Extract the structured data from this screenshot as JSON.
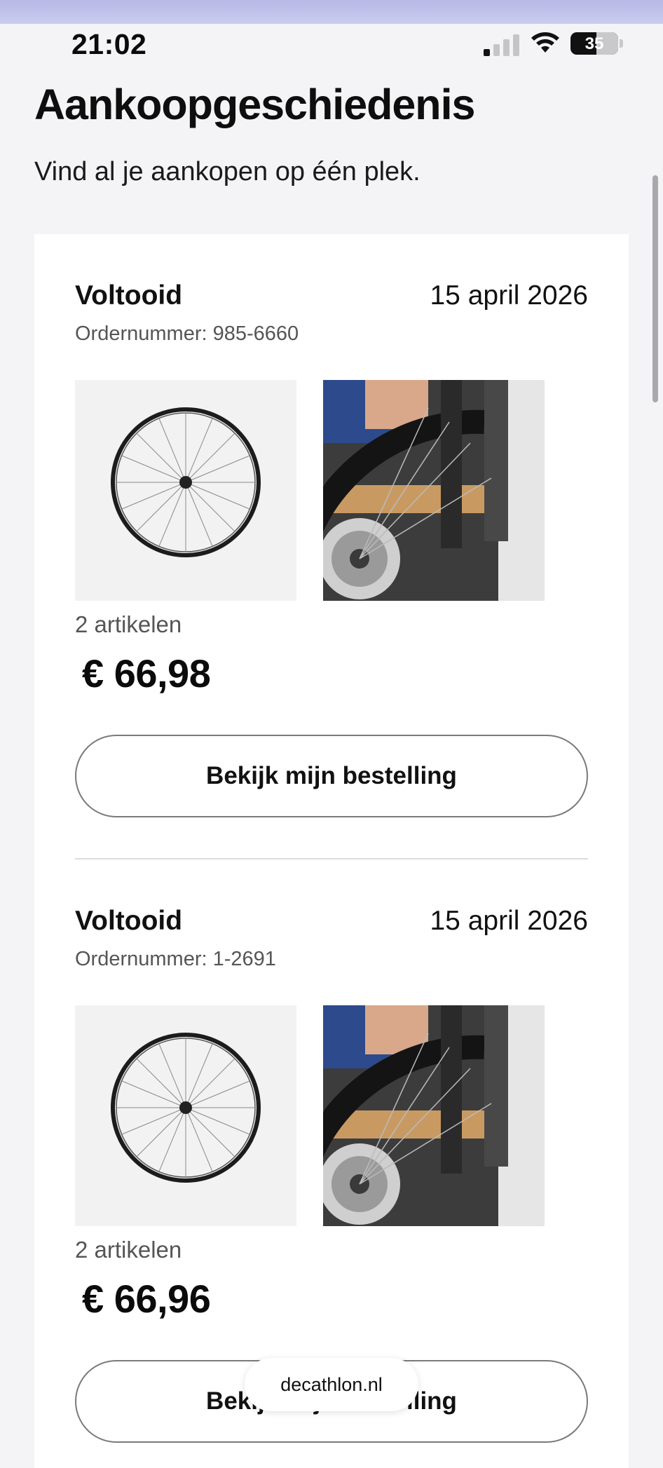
{
  "status_bar": {
    "time": "21:02",
    "battery_percent": "35",
    "signal_bars_active": 1,
    "icons": [
      "cellular-signal-icon",
      "wifi-icon",
      "battery-icon"
    ]
  },
  "page": {
    "title": "Aankoopgeschiedenis",
    "subtitle": "Vind al je aankopen op één plek."
  },
  "orders": [
    {
      "status": "Voltooid",
      "date": "15 april 2026",
      "order_number": "Ordernummer: 985-6660",
      "item_count": "2 artikelen",
      "total": "€ 66,98",
      "button_label": "Bekijk mijn bestelling",
      "thumbnails": [
        "bicycle-wheel-image",
        "bike-fork-disc-brake-photo"
      ]
    },
    {
      "status": "Voltooid",
      "date": "15 april 2026",
      "order_number": "Ordernummer: 1-2691",
      "item_count": "2 artikelen",
      "total": "€ 66,96",
      "button_label": "Bekijk mijn bestelling",
      "thumbnails": [
        "bicycle-wheel-image",
        "bike-fork-disc-brake-photo"
      ]
    }
  ],
  "browser": {
    "url": "decathlon.nl"
  },
  "colors": {
    "background": "#f4f4f6",
    "card": "#ffffff",
    "text": "#101010",
    "muted_text": "#555555",
    "button_border": "#7a7a7a",
    "top_tint": "#b7b9e6"
  }
}
